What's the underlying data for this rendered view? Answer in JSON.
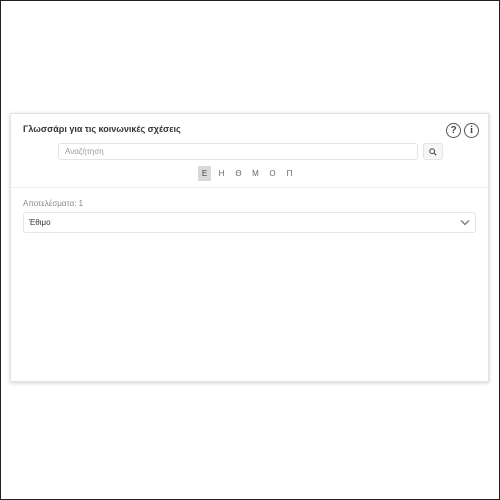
{
  "widget": {
    "title": "Γλωσσάρι για τις κοινωνικές σχέσεις",
    "help_icon": "question-circle-icon",
    "info_icon": "info-circle-icon"
  },
  "search": {
    "placeholder": "Αναζήτηση",
    "value": "",
    "button_icon": "search-icon"
  },
  "letters": [
    {
      "label": "Ε",
      "active": true
    },
    {
      "label": "Η",
      "active": false
    },
    {
      "label": "Θ",
      "active": false
    },
    {
      "label": "Μ",
      "active": false
    },
    {
      "label": "Ο",
      "active": false
    },
    {
      "label": "Π",
      "active": false
    }
  ],
  "results": {
    "label": "Αποτελέσματα: 1",
    "items": [
      {
        "text": "Έθιμο",
        "expand_icon": "chevron-down-icon"
      }
    ]
  }
}
